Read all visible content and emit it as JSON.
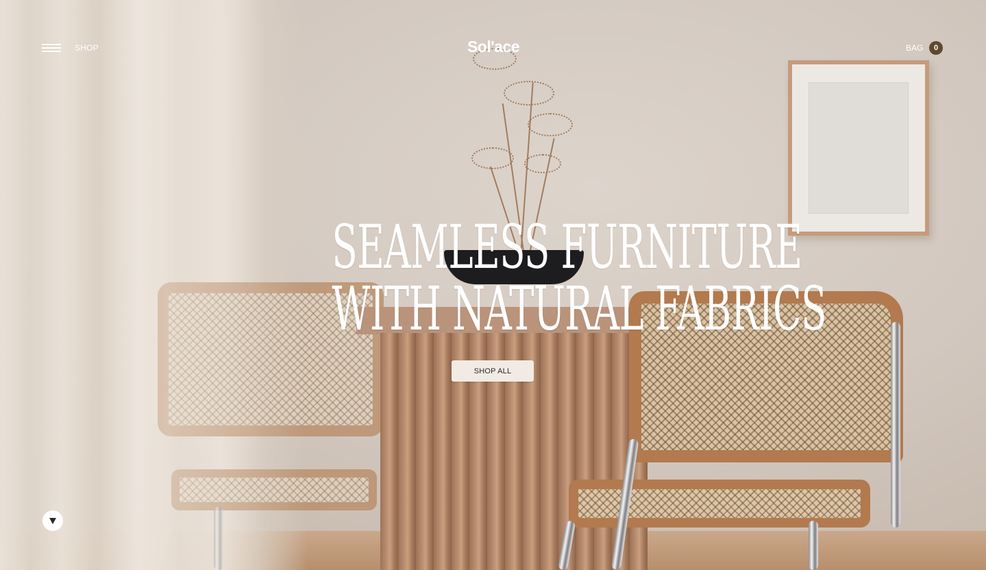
{
  "header": {
    "shop_label": "SHOP",
    "logo_text": "Sol'ace",
    "bag_label": "BAG",
    "bag_count": "0",
    "menu_icon": "hamburger-icon"
  },
  "hero": {
    "headline_line1": "SEAMLESS FURNITURE",
    "headline_line2": "WITH NATURAL FABRICS",
    "cta_label": "SHOP ALL",
    "scroll_icon": "arrow-down-icon"
  },
  "colors": {
    "text_light": "#ffffff",
    "badge_bg": "#5f4a2c",
    "cta_bg": "#f1ebe4",
    "cta_text": "#2b2621"
  }
}
